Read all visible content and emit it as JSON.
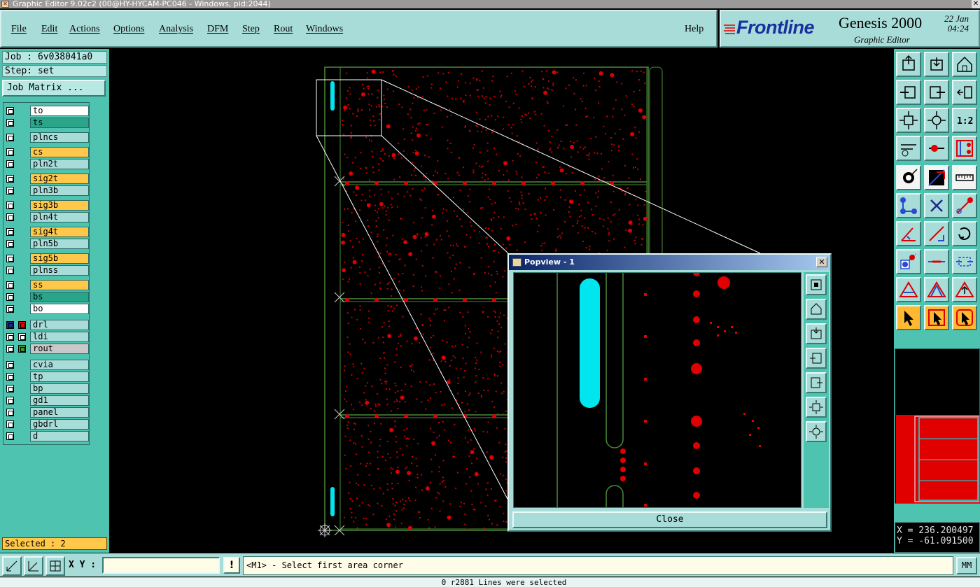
{
  "window": {
    "title": "Graphic Editor 9.02c2 (00@HY-HYCAM-PC046 - Windows, pid:2044)"
  },
  "menu": [
    "File",
    "Edit",
    "Actions",
    "Options",
    "Analysis",
    "DFM",
    "Step",
    "Rout",
    "Windows"
  ],
  "help_label": "Help",
  "brand": {
    "logo": "Frontline",
    "product": "Genesis 2000",
    "subtitle": "Graphic Editor",
    "date": "22 Jan",
    "time": "04:24"
  },
  "job": "Job : 6v038041a0",
  "step": "Step: set",
  "job_matrix_label": "Job Matrix ...",
  "layers": [
    {
      "name": "to",
      "color": "#ffffff"
    },
    {
      "name": "ts",
      "color": "#2aa58a"
    },
    {
      "name": "plncs",
      "color": "#a8dcd8"
    },
    {
      "name": "cs",
      "color": "#ffc84a"
    },
    {
      "name": "pln2t",
      "color": "#a8dcd8"
    },
    {
      "name": "sig2t",
      "color": "#ffc84a"
    },
    {
      "name": "pln3b",
      "color": "#a8dcd8"
    },
    {
      "name": "sig3b",
      "color": "#ffc84a"
    },
    {
      "name": "pln4t",
      "color": "#a8dcd8"
    },
    {
      "name": "sig4t",
      "color": "#ffc84a"
    },
    {
      "name": "pln5b",
      "color": "#a8dcd8"
    },
    {
      "name": "sig5b",
      "color": "#ffc84a"
    },
    {
      "name": "plnss",
      "color": "#a8dcd8"
    },
    {
      "name": "ss",
      "color": "#ffc84a"
    },
    {
      "name": "bs",
      "color": "#2aa58a"
    },
    {
      "name": "bo",
      "color": "#ffffff"
    },
    {
      "name": "drl",
      "color": "#a8dcd8"
    },
    {
      "name": "ldi",
      "color": "#a8dcd8"
    },
    {
      "name": "rout",
      "color": "#c8c8c8"
    },
    {
      "name": "cvia",
      "color": "#a8dcd8"
    },
    {
      "name": "tp",
      "color": "#a8dcd8"
    },
    {
      "name": "bp",
      "color": "#a8dcd8"
    },
    {
      "name": "gd1",
      "color": "#a8dcd8"
    },
    {
      "name": "panel",
      "color": "#a8dcd8"
    },
    {
      "name": "gbdrl",
      "color": "#a8dcd8"
    },
    {
      "name": "d",
      "color": "#a8dcd8"
    }
  ],
  "selected": "Selected : 2",
  "coords": {
    "x": "X = 236.200497",
    "y": "Y = -61.091500"
  },
  "xy_label": "X Y :",
  "xy_value": "",
  "excl": "!",
  "message": "<M1> - Select first area corner",
  "units": "MM",
  "status": "0 r2881 Lines were selected",
  "popview": {
    "title": "Popview - 1",
    "close_label": "Close",
    "close_x": "✕"
  },
  "tool_icons": [
    "home-step-icon",
    "open-step-icon",
    "home-icon",
    "zoom-left-icon",
    "zoom-right-icon",
    "pan-icon",
    "zoom-fit-icon",
    "zoom-center-icon",
    "scale-1-2-icon",
    "measure-tool-icon",
    "snap-icon",
    "profile-icon",
    "add-pad-icon",
    "line-diagonal-icon",
    "ruler-icon",
    "connect-nodes-icon",
    "cross-icon",
    "line-draw-icon",
    "angle-icon",
    "line-tool-icon",
    "rotate-icon",
    "pad-select-icon",
    "dash-line-icon",
    "resize-icon",
    "triangle-icon",
    "arrow-up-triangle-icon",
    "peak-icon",
    "select-pointer-icon",
    "select-box-icon",
    "select-net-icon"
  ],
  "colors": {
    "accent": "#4ec3b0",
    "panel": "#a8dcd8",
    "copper": "#e00000",
    "outline": "#4a8a3a",
    "cyan": "#00e5ee"
  }
}
